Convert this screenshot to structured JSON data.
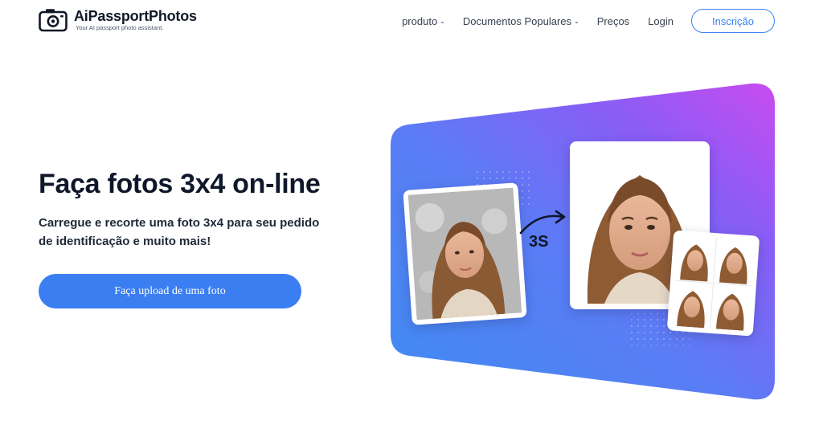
{
  "brand": {
    "name": "AiPassportPhotos",
    "tagline": "Your AI passport photo assistant."
  },
  "nav": {
    "produto": "produto",
    "documentos": "Documentos Populares",
    "precos": "Preços",
    "login": "Login",
    "signup": "Inscrição"
  },
  "hero": {
    "title": "Faça fotos 3x4 on-line",
    "subtitle": "Carregue e recorte uma foto 3x4 para seu pedido de identificação e muito mais!",
    "upload_button": "Faça upload de uma foto",
    "time_label": "3S"
  },
  "colors": {
    "accent": "#3b7ef2",
    "gradient_start": "#4f8df5",
    "gradient_mid": "#8b5cf6",
    "gradient_end": "#d946ef"
  }
}
